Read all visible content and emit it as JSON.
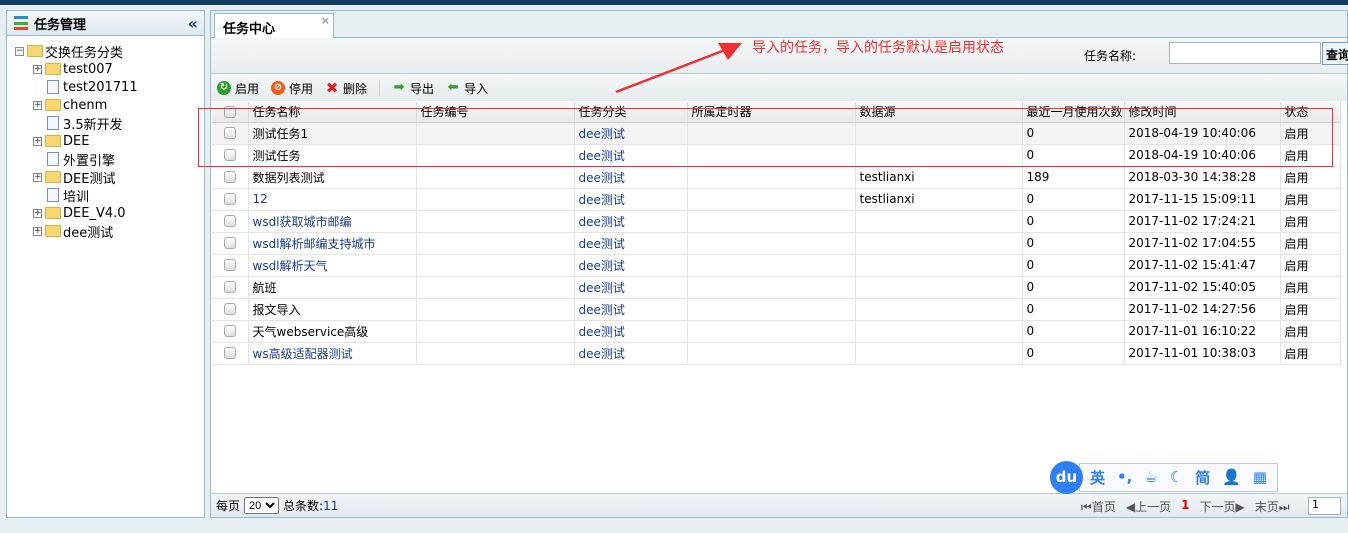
{
  "left": {
    "title": "任务管理",
    "root": "交换任务分类",
    "nodes": [
      {
        "label": "test007",
        "type": "folder"
      },
      {
        "label": "test201711",
        "type": "file"
      },
      {
        "label": "chenm",
        "type": "folder"
      },
      {
        "label": "3.5新开发",
        "type": "file"
      },
      {
        "label": "DEE",
        "type": "folder"
      },
      {
        "label": "外置引擎",
        "type": "file"
      },
      {
        "label": "DEE测试",
        "type": "folder"
      },
      {
        "label": "培训",
        "type": "file"
      },
      {
        "label": "DEE_V4.0",
        "type": "folder"
      },
      {
        "label": "dee测试",
        "type": "folder"
      }
    ]
  },
  "tab": {
    "label": "任务中心",
    "close": "×"
  },
  "search": {
    "label": "任务名称:",
    "value": "",
    "button": "查询"
  },
  "toolbar": {
    "enable": "启用",
    "disable": "停用",
    "delete": "删除",
    "export": "导出",
    "import": "导入"
  },
  "table": {
    "columns": [
      "任务名称",
      "任务编号",
      "任务分类",
      "所属定时器",
      "数据源",
      "最近一月使用次数",
      "修改时间",
      "状态"
    ],
    "rows": [
      [
        "测试任务1",
        "",
        "dee测试",
        "",
        "",
        "0",
        "2018-04-19 10:40:06",
        "启用"
      ],
      [
        "测试任务",
        "",
        "dee测试",
        "",
        "",
        "0",
        "2018-04-19 10:40:06",
        "启用"
      ],
      [
        "数据列表测试",
        "",
        "dee测试",
        "",
        "testlianxi",
        "189",
        "2018-03-30 14:38:28",
        "启用"
      ],
      [
        "12",
        "",
        "dee测试",
        "",
        "testlianxi",
        "0",
        "2017-11-15 15:09:11",
        "启用"
      ],
      [
        "wsdl获取城市邮编",
        "",
        "dee测试",
        "",
        "",
        "0",
        "2017-11-02 17:24:21",
        "启用"
      ],
      [
        "wsdl解析邮编支持城市",
        "",
        "dee测试",
        "",
        "",
        "0",
        "2017-11-02 17:04:55",
        "启用"
      ],
      [
        "wsdl解析天气",
        "",
        "dee测试",
        "",
        "",
        "0",
        "2017-11-02 15:41:47",
        "启用"
      ],
      [
        "航班",
        "",
        "dee测试",
        "",
        "",
        "0",
        "2017-11-02 15:40:05",
        "启用"
      ],
      [
        "报文导入",
        "",
        "dee测试",
        "",
        "",
        "0",
        "2017-11-02 14:27:56",
        "启用"
      ],
      [
        "天气webservice高级",
        "",
        "dee测试",
        "",
        "",
        "0",
        "2017-11-01 16:10:22",
        "启用"
      ],
      [
        "ws高级适配器测试",
        "",
        "dee测试",
        "",
        "",
        "0",
        "2017-11-01 10:38:03",
        "启用"
      ]
    ]
  },
  "footer": {
    "per_page_label": "每页",
    "per_page": "20",
    "total_label": "总条数:",
    "total": "11",
    "first": "首页",
    "prev": "上一页",
    "current": "1",
    "next": "下一页",
    "last": "末页",
    "page_input": "1"
  },
  "annotation": {
    "note": "导入的任务，导入的任务默认是启用状态",
    "color": "#f03030"
  },
  "ime": {
    "logo": "du",
    "items": [
      "英",
      "•,",
      "☕",
      "☾",
      "简",
      "👤",
      "▦"
    ]
  }
}
